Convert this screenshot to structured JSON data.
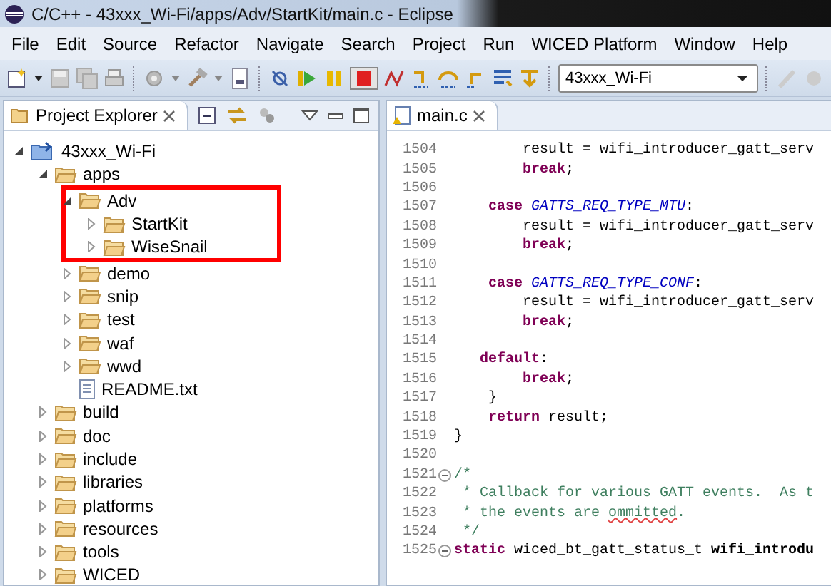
{
  "window": {
    "title": "C/C++ - 43xxx_Wi-Fi/apps/Adv/StartKit/main.c - Eclipse"
  },
  "menu": [
    "File",
    "Edit",
    "Source",
    "Refactor",
    "Navigate",
    "Search",
    "Project",
    "Run",
    "WICED Platform",
    "Window",
    "Help"
  ],
  "toolbar": {
    "target_dropdown": "43xxx_Wi-Fi"
  },
  "explorer": {
    "tab": "Project Explorer",
    "tree": [
      {
        "label": "43xxx_Wi-Fi",
        "kind": "project",
        "expanded": true,
        "children": [
          {
            "label": "apps",
            "kind": "folder",
            "expanded": true,
            "children": [
              {
                "label": "Adv",
                "kind": "folder",
                "expanded": true,
                "highlighted": true,
                "children": [
                  {
                    "label": "StartKit",
                    "kind": "folder",
                    "expanded": false
                  },
                  {
                    "label": "WiseSnail",
                    "kind": "folder",
                    "expanded": false
                  }
                ]
              },
              {
                "label": "demo",
                "kind": "folder",
                "expanded": false
              },
              {
                "label": "snip",
                "kind": "folder",
                "expanded": false
              },
              {
                "label": "test",
                "kind": "folder",
                "expanded": false
              },
              {
                "label": "waf",
                "kind": "folder",
                "expanded": false
              },
              {
                "label": "wwd",
                "kind": "folder",
                "expanded": false
              },
              {
                "label": "README.txt",
                "kind": "file"
              }
            ]
          },
          {
            "label": "build",
            "kind": "folder",
            "expanded": false
          },
          {
            "label": "doc",
            "kind": "folder",
            "expanded": false
          },
          {
            "label": "include",
            "kind": "folder",
            "expanded": false
          },
          {
            "label": "libraries",
            "kind": "folder",
            "expanded": false
          },
          {
            "label": "platforms",
            "kind": "folder",
            "expanded": false
          },
          {
            "label": "resources",
            "kind": "folder",
            "expanded": false
          },
          {
            "label": "tools",
            "kind": "folder",
            "expanded": false
          },
          {
            "label": "WICED",
            "kind": "folder",
            "expanded": false
          }
        ]
      }
    ]
  },
  "editor": {
    "tab": "main.c",
    "lines": [
      {
        "num": "1504",
        "segments": [
          {
            "kind": "plain",
            "text": "        result = wifi_introducer_gatt_serv"
          }
        ]
      },
      {
        "num": "1505",
        "segments": [
          {
            "kind": "keyword",
            "text": "        break"
          },
          {
            "kind": "plain",
            "text": ";"
          }
        ]
      },
      {
        "num": "1506"
      },
      {
        "num": "1507",
        "segments": [
          {
            "kind": "keyword",
            "text": "    case"
          },
          {
            "kind": "constant",
            "text": " GATTS_REQ_TYPE_MTU"
          },
          {
            "kind": "plain",
            "text": ":"
          }
        ]
      },
      {
        "num": "1508",
        "segments": [
          {
            "kind": "plain",
            "text": "        result = wifi_introducer_gatt_serv"
          }
        ]
      },
      {
        "num": "1509",
        "segments": [
          {
            "kind": "keyword",
            "text": "        break"
          },
          {
            "kind": "plain",
            "text": ";"
          }
        ]
      },
      {
        "num": "1510"
      },
      {
        "num": "1511",
        "segments": [
          {
            "kind": "keyword",
            "text": "    case"
          },
          {
            "kind": "constant",
            "text": " GATTS_REQ_TYPE_CONF"
          },
          {
            "kind": "plain",
            "text": ":"
          }
        ]
      },
      {
        "num": "1512",
        "segments": [
          {
            "kind": "plain",
            "text": "        result = wifi_introducer_gatt_serv"
          }
        ]
      },
      {
        "num": "1513",
        "segments": [
          {
            "kind": "keyword",
            "text": "        break"
          },
          {
            "kind": "plain",
            "text": ";"
          }
        ]
      },
      {
        "num": "1514"
      },
      {
        "num": "1515",
        "segments": [
          {
            "kind": "keyword",
            "text": "   default"
          },
          {
            "kind": "plain",
            "text": ":"
          }
        ]
      },
      {
        "num": "1516",
        "segments": [
          {
            "kind": "keyword",
            "text": "        break"
          },
          {
            "kind": "plain",
            "text": ";"
          }
        ]
      },
      {
        "num": "1517",
        "segments": [
          {
            "kind": "plain",
            "text": "    }"
          }
        ]
      },
      {
        "num": "1518",
        "segments": [
          {
            "kind": "keyword",
            "text": "    return"
          },
          {
            "kind": "plain",
            "text": " result;"
          }
        ]
      },
      {
        "num": "1519",
        "segments": [
          {
            "kind": "plain",
            "text": "}"
          }
        ]
      },
      {
        "num": "1520"
      },
      {
        "num": "1521",
        "fold": true,
        "segments": [
          {
            "kind": "comment",
            "text": "/*"
          }
        ]
      },
      {
        "num": "1522",
        "segments": [
          {
            "kind": "comment",
            "text": " * Callback for various GATT events.  As t"
          }
        ]
      },
      {
        "num": "1523",
        "segments": [
          {
            "kind": "comment",
            "text": " * the events are "
          },
          {
            "kind": "misspelled",
            "text": "ommitted"
          },
          {
            "kind": "comment",
            "text": "."
          }
        ]
      },
      {
        "num": "1524",
        "segments": [
          {
            "kind": "comment",
            "text": " */"
          }
        ]
      },
      {
        "num": "1525",
        "fold": true,
        "segments": [
          {
            "kind": "keyword",
            "text": "static"
          },
          {
            "kind": "plain",
            "text": " wiced_bt_gatt_status_t "
          },
          {
            "kind": "bold",
            "text": "wifi_introdu"
          }
        ]
      }
    ]
  }
}
